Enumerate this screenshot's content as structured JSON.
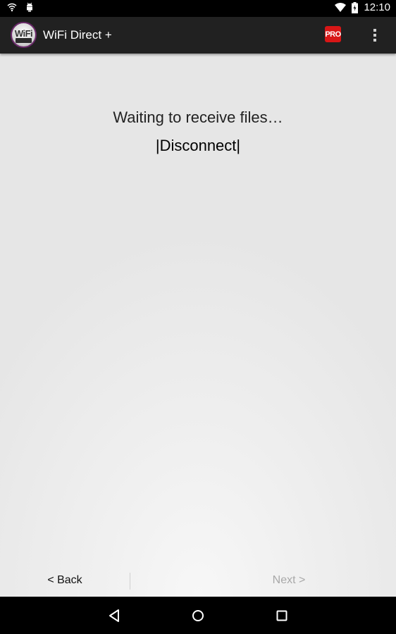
{
  "status_bar": {
    "time": "12:10",
    "icons": [
      "wifi-notification-icon",
      "android-debug-icon",
      "wifi-signal-icon",
      "battery-charging-icon"
    ]
  },
  "action_bar": {
    "title": "WiFi Direct +",
    "logo_text": "WiFi",
    "pro_label": "PRO",
    "menu_icon": "overflow-menu-icon"
  },
  "main": {
    "status_text": "Waiting to receive files…",
    "disconnect_label": "|Disconnect|"
  },
  "bottom_bar": {
    "back_label": "< Back",
    "next_label": "Next >"
  },
  "nav_bar": {
    "icons": [
      "back-nav-icon",
      "home-nav-icon",
      "recents-nav-icon"
    ]
  },
  "colors": {
    "action_bar_bg": "#212121",
    "pro_badge": "#d81616",
    "next_disabled": "#a8a8a8"
  }
}
